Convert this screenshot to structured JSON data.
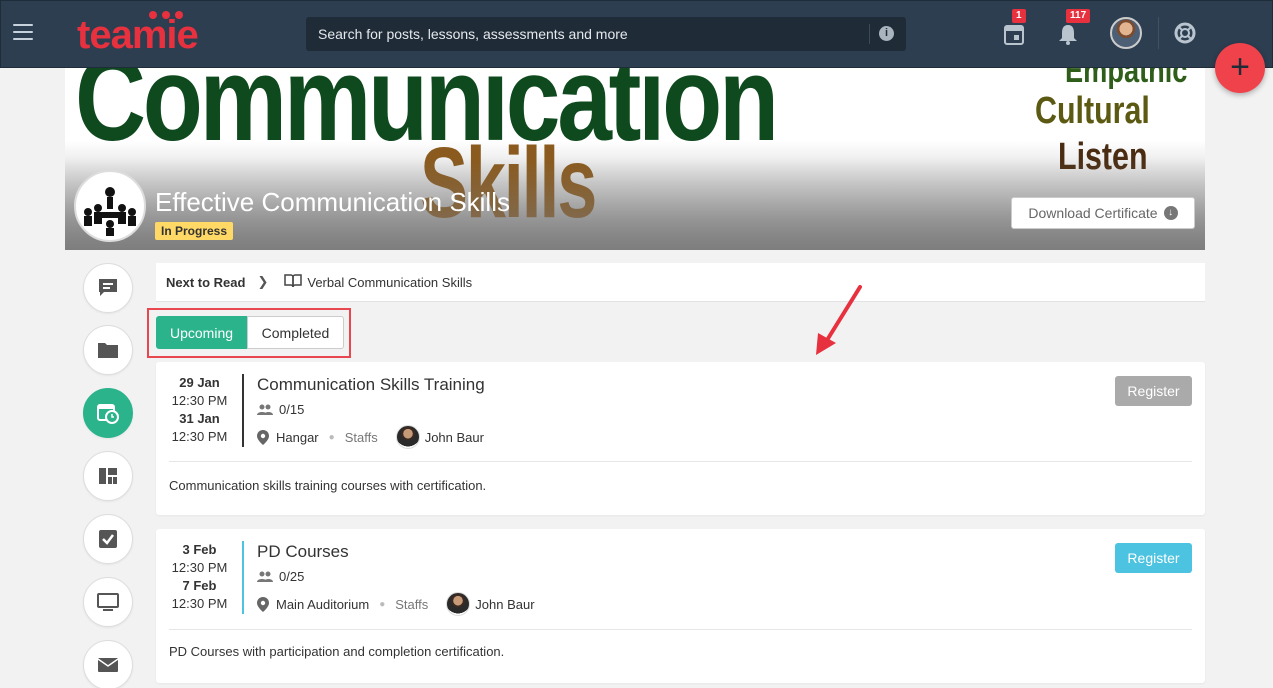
{
  "topbar": {
    "logo": "teamie",
    "search_placeholder": "Search for posts, lessons, assessments and more",
    "calendar_badge": "1",
    "notification_badge": "117",
    "fab_label": "+"
  },
  "banner": {
    "word_main": "Communication",
    "word_skills": "Skills",
    "word_empathy": "Empathic",
    "word_cultural": "Cultural",
    "word_listen": "Listen",
    "course_title": "Effective Communication Skills",
    "status": "In Progress",
    "download_label": "Download Certificate"
  },
  "rail": {
    "items": [
      {
        "icon": "chat-icon"
      },
      {
        "icon": "folder-icon"
      },
      {
        "icon": "calendar-clock-icon",
        "active": true
      },
      {
        "icon": "dashboard-icon"
      },
      {
        "icon": "checkbox-icon"
      },
      {
        "icon": "monitor-icon"
      },
      {
        "icon": "mail-icon"
      }
    ]
  },
  "next_read": {
    "label": "Next to Read",
    "lesson": "Verbal Communication Skills"
  },
  "tabs": {
    "upcoming": "Upcoming",
    "completed": "Completed",
    "active": "upcoming"
  },
  "events": [
    {
      "start_date": "29 Jan",
      "start_time": "12:30 PM",
      "end_date": "31 Jan",
      "end_time": "12:30 PM",
      "title": "Communication Skills Training",
      "seats": "0/15",
      "location": "Hangar",
      "audience": "Staffs",
      "host": "John Baur",
      "register_label": "Register",
      "register_color": "#aaaaaa",
      "accent_color": "#333333",
      "description": "Communication skills training courses with certification."
    },
    {
      "start_date": "3 Feb",
      "start_time": "12:30 PM",
      "end_date": "7 Feb",
      "end_time": "12:30 PM",
      "title": "PD Courses",
      "seats": "0/25",
      "location": "Main Auditorium",
      "audience": "Staffs",
      "host": "John Baur",
      "register_label": "Register",
      "register_color": "#4cc3e0",
      "accent_color": "#4cc3e0",
      "description": "PD Courses with participation and completion certification."
    }
  ],
  "colors": {
    "topbar": "#2c3e50",
    "accent_green": "#2bb38c",
    "highlight_red": "#e8474f",
    "fab": "#f0424b"
  }
}
